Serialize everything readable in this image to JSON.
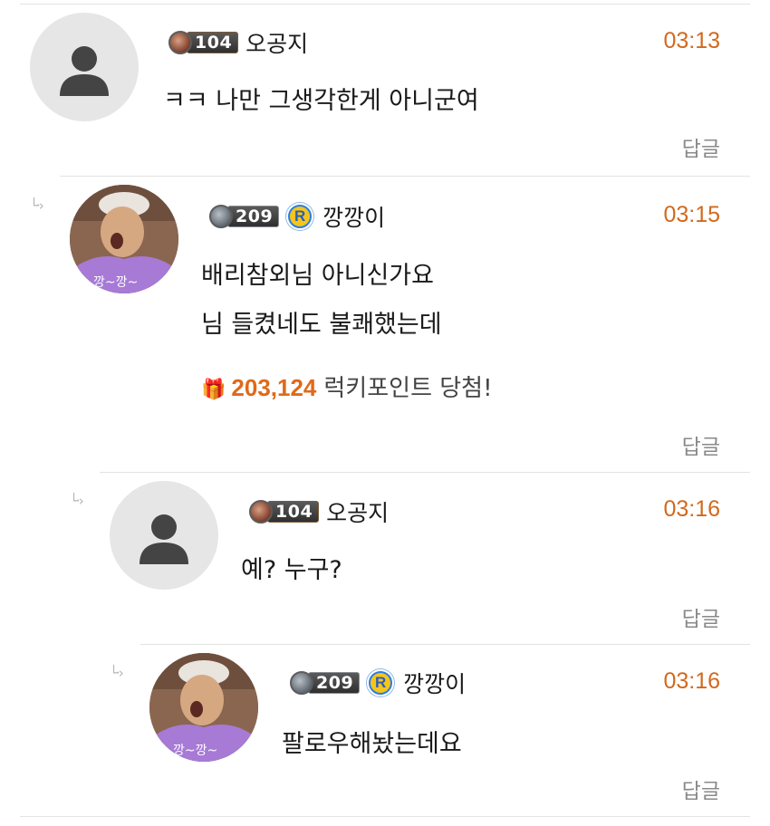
{
  "comments": [
    {
      "level": "104",
      "rank_letter": null,
      "username": "오공지",
      "time": "03:13",
      "lines": [
        "ㅋㅋ 나만 그생각한게 아니군여"
      ],
      "reply_label": "답글",
      "avatar": "default-user-icon"
    },
    {
      "level": "209",
      "rank_letter": "R",
      "username": "깡깡이",
      "time": "03:15",
      "lines": [
        "배리참외님 아니신가요",
        "님 들켰네도 불쾌했는데"
      ],
      "lucky_points": "203,124",
      "lucky_text": "럭키포인트 당첨!",
      "reply_label": "답글",
      "avatar": "profile-photo"
    },
    {
      "level": "104",
      "rank_letter": null,
      "username": "오공지",
      "time": "03:16",
      "lines": [
        "예? 누구?"
      ],
      "reply_label": "답글",
      "avatar": "default-user-icon"
    },
    {
      "level": "209",
      "rank_letter": "R",
      "username": "깡깡이",
      "time": "03:16",
      "lines": [
        "팔로우해놨는데요"
      ],
      "reply_label": "답글",
      "avatar": "profile-photo"
    }
  ],
  "colors": {
    "timestamp": "#d2691e",
    "lucky_amount": "#e0691a",
    "rank_badge_bg": "#2e7de0",
    "rank_badge_letter_bg": "#f5c51b"
  }
}
